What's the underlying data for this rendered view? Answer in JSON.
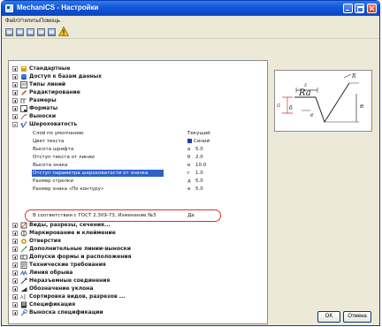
{
  "window": {
    "title": "MechaniCS - Настройки",
    "accent": "#1357d6"
  },
  "menu": [
    "Файл",
    "Утилиты",
    "Помощь"
  ],
  "toolbar": {
    "buttons": [
      "tool-button",
      "tool-button",
      "tool-button",
      "tool-button",
      "tool-button"
    ],
    "warning_icon": "warning-icon"
  },
  "tree": {
    "categories_top": [
      {
        "label": "Стандартные",
        "icon": "standards-icon"
      },
      {
        "label": "Доступ к базам данных",
        "icon": "database-icon"
      },
      {
        "label": "Типы линий",
        "icon": "line-types-icon"
      },
      {
        "label": "Редактирование",
        "icon": "edit-icon"
      },
      {
        "label": "Размеры",
        "icon": "dimensions-icon"
      },
      {
        "label": "Форматы",
        "icon": "formats-icon"
      },
      {
        "label": "Выноски",
        "icon": "leaders-icon"
      }
    ],
    "expanded": {
      "label": "Шероховатость",
      "icon": "roughness-icon",
      "properties": [
        {
          "name": "Слой по умолчанию",
          "key": "",
          "value": "Текущий"
        },
        {
          "name": "Цвет текста",
          "key": "",
          "value": "Синий",
          "swatch": "#1c3fa8"
        },
        {
          "name": "Высота шрифта",
          "key": "a",
          "value": "5.0"
        },
        {
          "name": "Отступ текста от линии",
          "key": "б",
          "value": "2.0"
        },
        {
          "name": "Высота знака",
          "key": "в",
          "value": "10.0"
        },
        {
          "name": "Отступ параметра шероховатости от значка",
          "key": "г",
          "value": "1.0",
          "selected": true
        },
        {
          "name": "Размер стрелки",
          "key": "д",
          "value": "5.0"
        },
        {
          "name": "Размер знака «По контуру»",
          "key": "е",
          "value": "5.0"
        },
        {
          "name": "В соответствии с ГОСТ 2.309-73, Изменение №3",
          "key": "",
          "value": "Да",
          "highlighted": true
        }
      ]
    },
    "categories_bottom": [
      {
        "label": "Виды, разрезы, сечения...",
        "icon": "views-icon"
      },
      {
        "label": "Маркирование и клеймение",
        "icon": "marking-icon"
      },
      {
        "label": "Отверстия",
        "icon": "holes-icon"
      },
      {
        "label": "Дополнительные линии-выноски",
        "icon": "extra-leaders-icon"
      },
      {
        "label": "Допуски формы и расположения",
        "icon": "tolerances-icon"
      },
      {
        "label": "Технические требования",
        "icon": "tech-requirements-icon"
      },
      {
        "label": "Линия обрыва",
        "icon": "break-line-icon"
      },
      {
        "label": "Неразъемные соединения",
        "icon": "joints-icon"
      },
      {
        "label": "Обозначение уклона",
        "icon": "slope-icon"
      },
      {
        "label": "Сортировка видов, разрезов ...",
        "icon": "sorting-icon"
      },
      {
        "label": "Спецификация",
        "icon": "specification-icon"
      },
      {
        "label": "Выноска спецификации",
        "icon": "spec-leader-icon"
      }
    ]
  },
  "preview": {
    "labels": [
      "z",
      "Ra",
      "R",
      "a",
      "б",
      "в",
      "e"
    ]
  },
  "buttons": {
    "ok": "OK",
    "cancel": "Отмена"
  }
}
